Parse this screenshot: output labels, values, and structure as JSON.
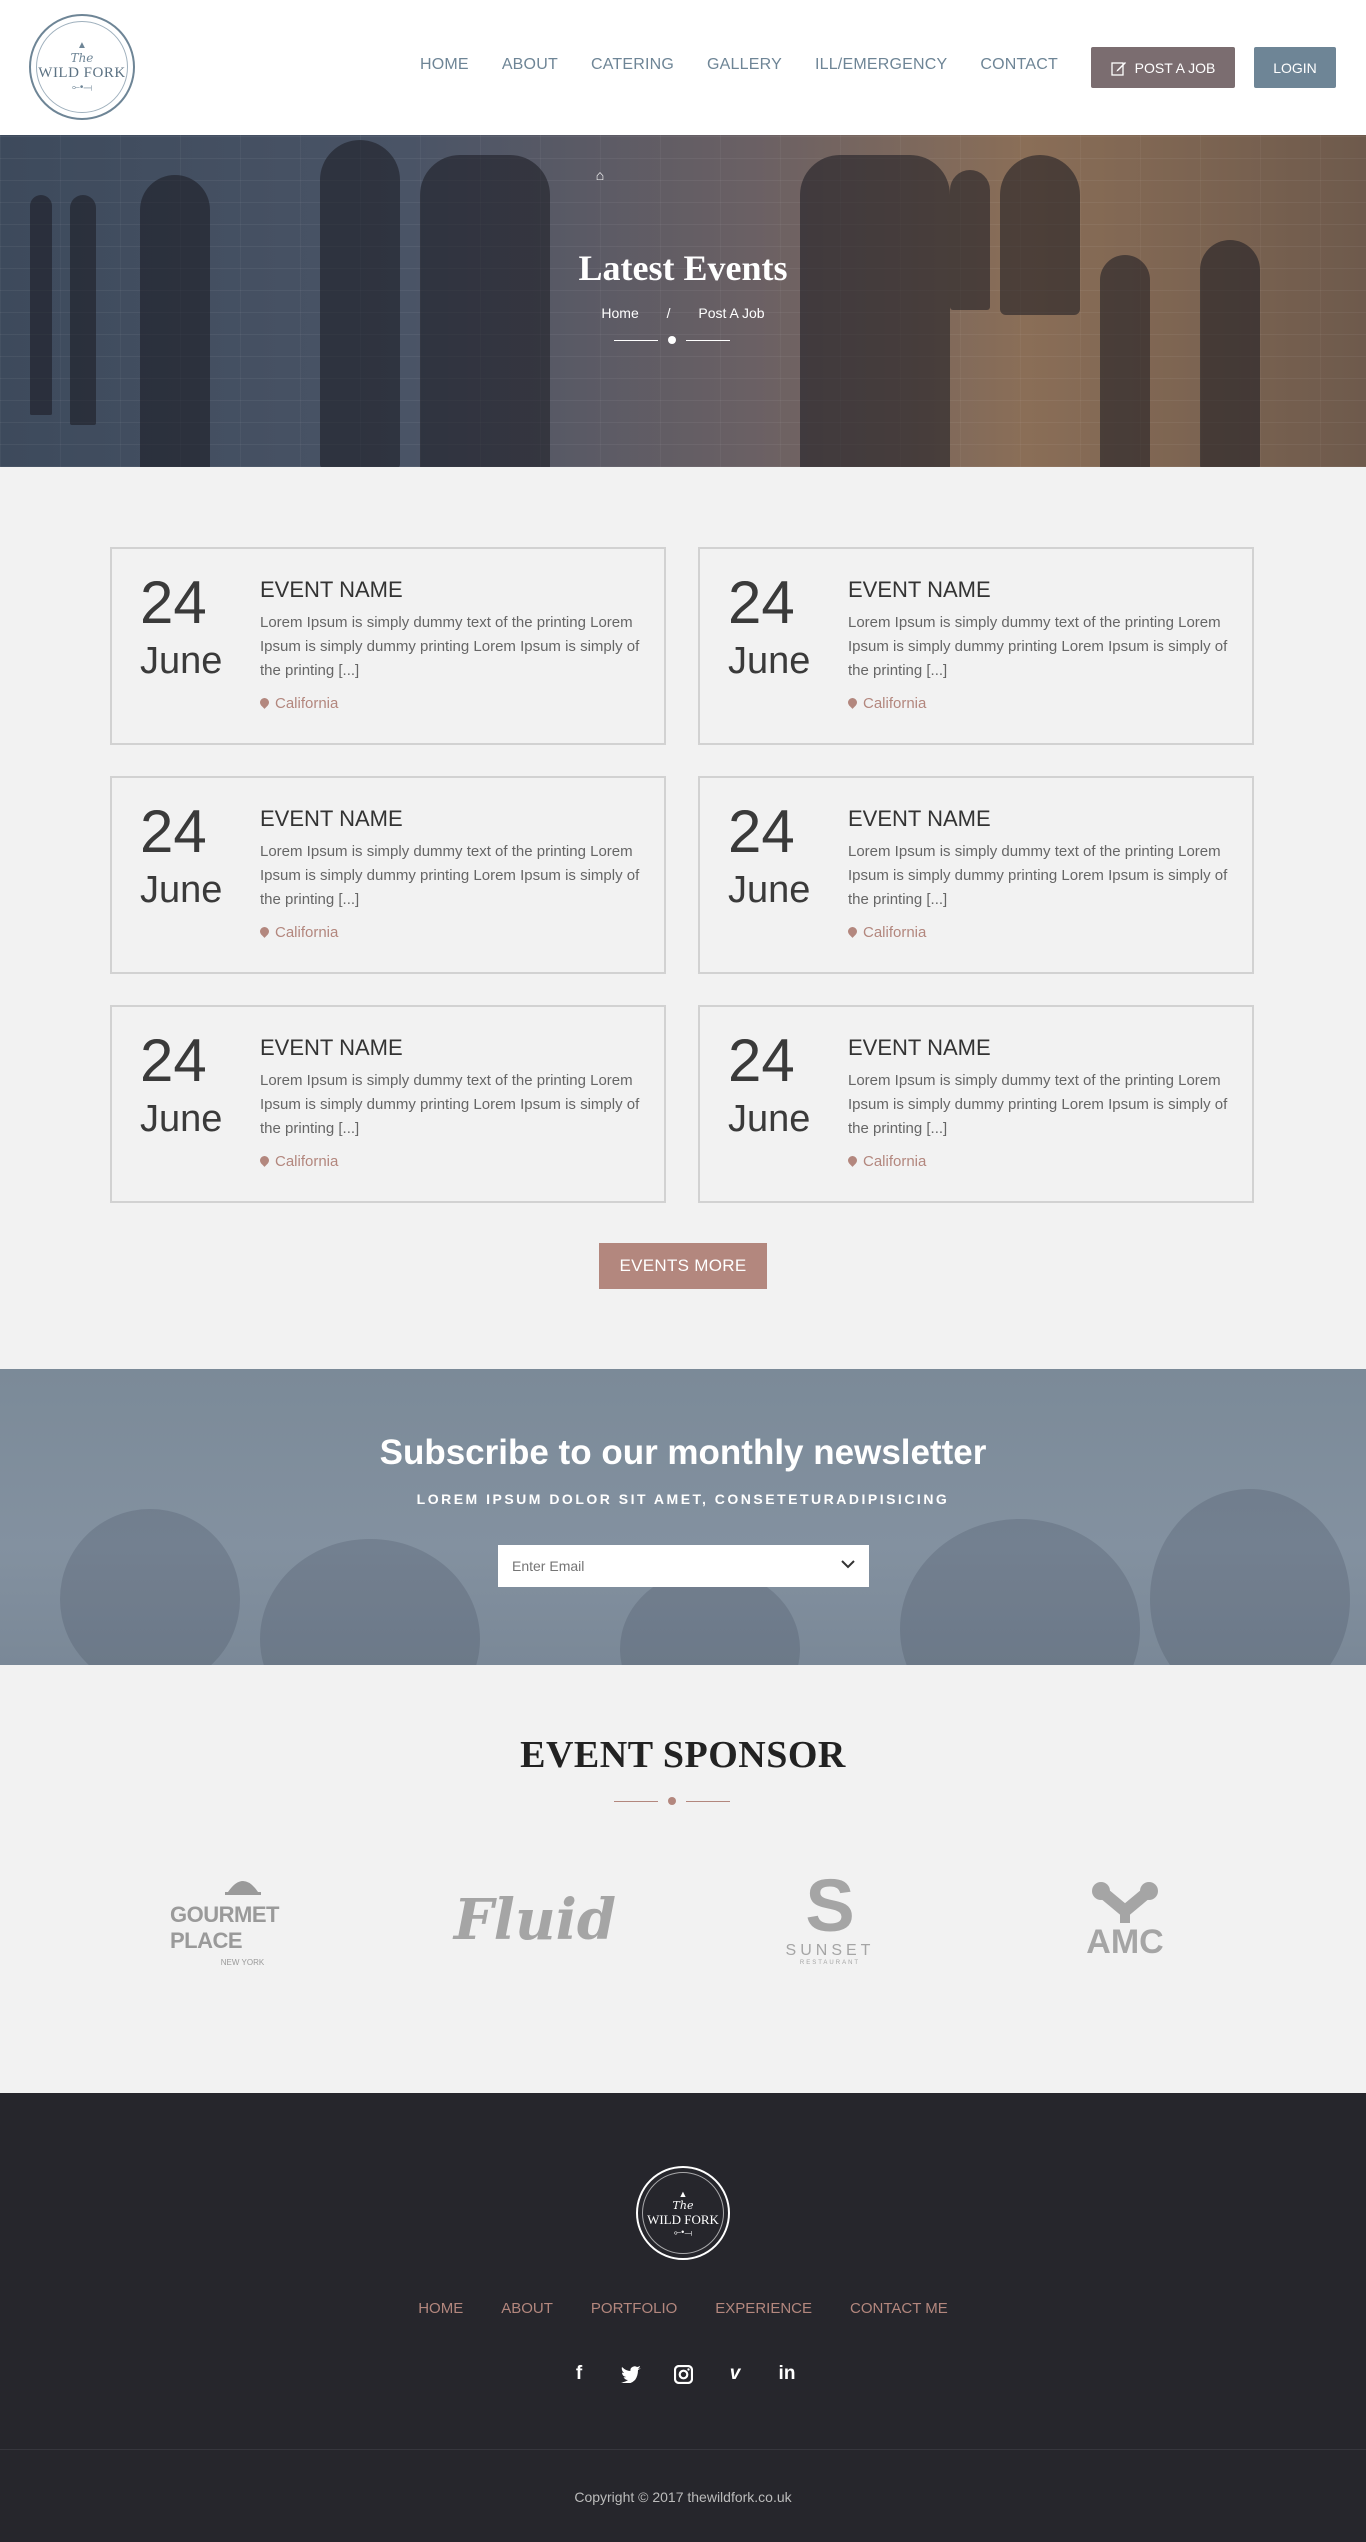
{
  "header": {
    "logo": {
      "the": "The",
      "name": "WILD FORK"
    },
    "nav": [
      "HOME",
      "ABOUT",
      "CATERING",
      "GALLERY",
      "ILL/EMERGENCY",
      "CONTACT"
    ],
    "post_job": "POST A JOB",
    "login": "LOGIN"
  },
  "hero": {
    "title": "Latest Events",
    "breadcrumb": {
      "home": "Home",
      "sep": "/",
      "current": "Post A Job"
    }
  },
  "events": [
    {
      "day": "24",
      "month": "June",
      "name": "EVENT NAME",
      "desc": "Lorem Ipsum is simply dummy text of the printing Lorem Ipsum is simply dummy  printing  Lorem Ipsum is simply of the printing [...]",
      "location": "California"
    },
    {
      "day": "24",
      "month": "June",
      "name": "EVENT NAME",
      "desc": "Lorem Ipsum is simply dummy text of the printing Lorem Ipsum is simply dummy  printing  Lorem Ipsum is simply of the printing [...]",
      "location": "California"
    },
    {
      "day": "24",
      "month": "June",
      "name": "EVENT NAME",
      "desc": "Lorem Ipsum is simply dummy text of the printing Lorem Ipsum is simply dummy  printing  Lorem Ipsum is simply of the printing [...]",
      "location": "California"
    },
    {
      "day": "24",
      "month": "June",
      "name": "EVENT NAME",
      "desc": "Lorem Ipsum is simply dummy text of the printing Lorem Ipsum is simply dummy  printing  Lorem Ipsum is simply of the printing [...]",
      "location": "California"
    },
    {
      "day": "24",
      "month": "June",
      "name": "EVENT NAME",
      "desc": "Lorem Ipsum is simply dummy text of the printing Lorem Ipsum is simply dummy  printing  Lorem Ipsum is simply of the printing [...]",
      "location": "California"
    },
    {
      "day": "24",
      "month": "June",
      "name": "EVENT NAME",
      "desc": "Lorem Ipsum is simply dummy text of the printing Lorem Ipsum is simply dummy  printing  Lorem Ipsum is simply of the printing [...]",
      "location": "California"
    }
  ],
  "events_more": "EVENTS MORE",
  "newsletter": {
    "title": "Subscribe to our monthly newsletter",
    "subtitle": "LOREM IPSUM DOLOR SIT AMET, CONSETETURADIPISICING",
    "placeholder": "Enter Email"
  },
  "sponsors": {
    "title": "EVENT SPONSOR",
    "items": [
      {
        "name": "GOURMET PLACE",
        "sub": "NEW YORK",
        "icon": "cloche-icon"
      },
      {
        "name": "Fluid",
        "icon": "fluid-logo"
      },
      {
        "name": "SUNSET",
        "sub": "RESTAURANT",
        "icon": "s-logo"
      },
      {
        "name": "AMC",
        "icon": "amc-logo"
      }
    ]
  },
  "footer": {
    "logo": {
      "the": "The",
      "name": "WILD FORK"
    },
    "nav": [
      "HOME",
      "ABOUT",
      "PORTFOLIO",
      "EXPERIENCE",
      "CONTACT ME"
    ],
    "social": [
      "facebook-icon",
      "twitter-icon",
      "instagram-icon",
      "vimeo-icon",
      "linkedin-icon"
    ],
    "copyright": "Copyright © 2017 thewildfork.co.uk"
  },
  "colors": {
    "accent": "#b3877e",
    "slate": "#6e8596",
    "footer_bg": "#26262c",
    "post_job_bg": "#7b6d70"
  }
}
